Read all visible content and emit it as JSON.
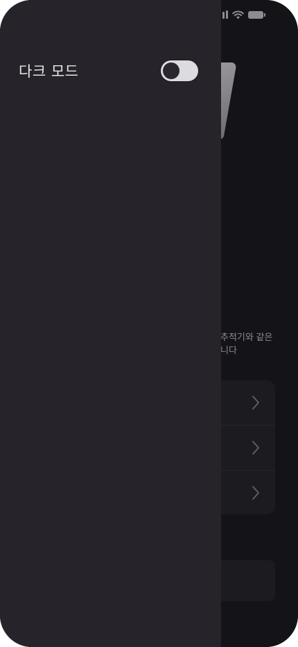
{
  "background_app": {
    "description_lines": [
      "추적기와 같은",
      "니다"
    ],
    "menu_rows": [
      {
        "icon": "chevron-right-icon"
      },
      {
        "icon": "chevron-right-icon"
      },
      {
        "icon": "chevron-right-icon"
      }
    ]
  },
  "drawer": {
    "dark_mode_label": "다크 모드",
    "dark_mode_toggle_on": false
  },
  "colors": {
    "drawer_bg": "#27232a",
    "app_bg": "#141317",
    "card_bg": "#1c1b20",
    "toggle_track": "#dcdbe0",
    "toggle_knob": "#2a2730"
  }
}
